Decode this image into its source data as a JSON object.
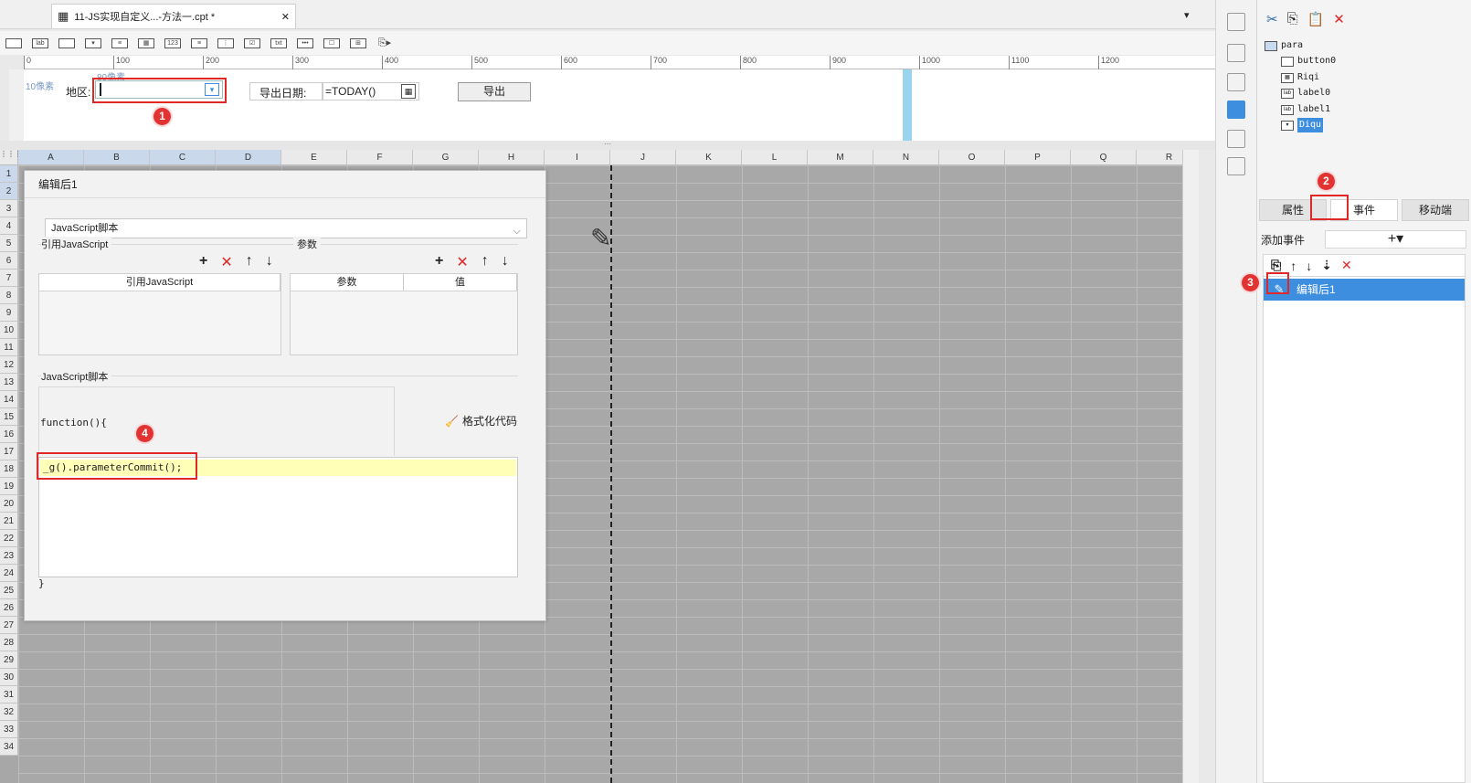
{
  "tab": {
    "title": "11-JS实现自定义...-方法一.cpt *",
    "close": "✕"
  },
  "ruler": {
    "ticks": [
      "0",
      "100",
      "200",
      "300",
      "400",
      "500",
      "600",
      "700",
      "800",
      "900",
      "1000",
      "1100",
      "1200"
    ]
  },
  "params": {
    "hint_10px": "10像素",
    "hint_80px": "80像素",
    "region_label": "地区:",
    "region_value": "",
    "date_label": "导出日期:",
    "date_value": "=TODAY()",
    "export_button": "导出"
  },
  "sheet": {
    "columns": [
      "A",
      "B",
      "C",
      "D",
      "E",
      "F",
      "G",
      "H",
      "I",
      "J",
      "K",
      "L",
      "M",
      "N",
      "O",
      "P",
      "Q",
      "R"
    ],
    "rows": [
      "1",
      "2",
      "3",
      "4",
      "5",
      "6",
      "7",
      "8",
      "9",
      "10",
      "11",
      "12",
      "13",
      "14",
      "15",
      "16",
      "17",
      "18",
      "19",
      "20",
      "21",
      "22",
      "23",
      "24",
      "25",
      "26",
      "27",
      "28",
      "29",
      "30",
      "31",
      "32",
      "33",
      "34"
    ]
  },
  "dialog": {
    "title": "编辑后1",
    "script_type": "JavaScript脚本",
    "ref_js_label": "引用JavaScript",
    "params_label": "参数",
    "ref_js_col": "引用JavaScript",
    "param_col": "参数",
    "value_col": "值",
    "js_script_label": "JavaScript脚本",
    "function_open": "function(){",
    "format_code": "格式化代码",
    "code_line": "_g().parameterCommit();",
    "function_close": "}"
  },
  "tree": {
    "root": "para",
    "children": [
      "button0",
      "Riqi",
      "label0",
      "label1",
      "Diqu"
    ],
    "selected": "Diqu"
  },
  "tabs": {
    "properties": "属性",
    "events": "事件",
    "mobile": "移动端"
  },
  "events": {
    "add_label": "添加事件",
    "add_btn": "+▾",
    "item": "编辑后1"
  },
  "badges": [
    "1",
    "2",
    "3",
    "4"
  ],
  "colors": {
    "accent": "#3e8ee0",
    "highlight_red": "#e02828",
    "code_highlight": "#ffffb8"
  }
}
